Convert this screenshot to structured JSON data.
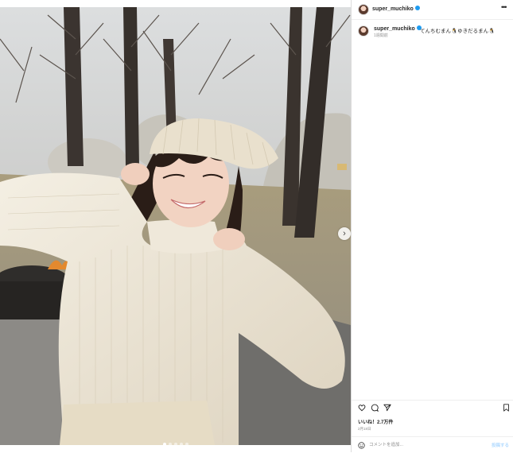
{
  "post": {
    "username": "super_muchiko",
    "caption": "てんちむまん🐧ゆきだるまん🐧",
    "time_ago": "1週間前",
    "likes_label": "いいね！2.7万件",
    "date": "2月18日"
  },
  "header": {
    "username": "super_muchiko",
    "more_label": "•••"
  },
  "carousel": {
    "next_label": "›",
    "slide_count": 5,
    "active_index": 0
  },
  "comment": {
    "placeholder": "コメントを追加...",
    "post_label": "投稿する"
  },
  "icons": {
    "like": "heart-icon",
    "comment": "comment-icon",
    "share": "paper-plane-icon",
    "save": "bookmark-icon",
    "emoji": "smiley-icon",
    "verified": "verified-badge-icon",
    "more": "more-dots-icon"
  },
  "colors": {
    "verified": "#1d9bf0",
    "post_button": "#b3dbff",
    "secondary_text": "#8e8e8e"
  }
}
